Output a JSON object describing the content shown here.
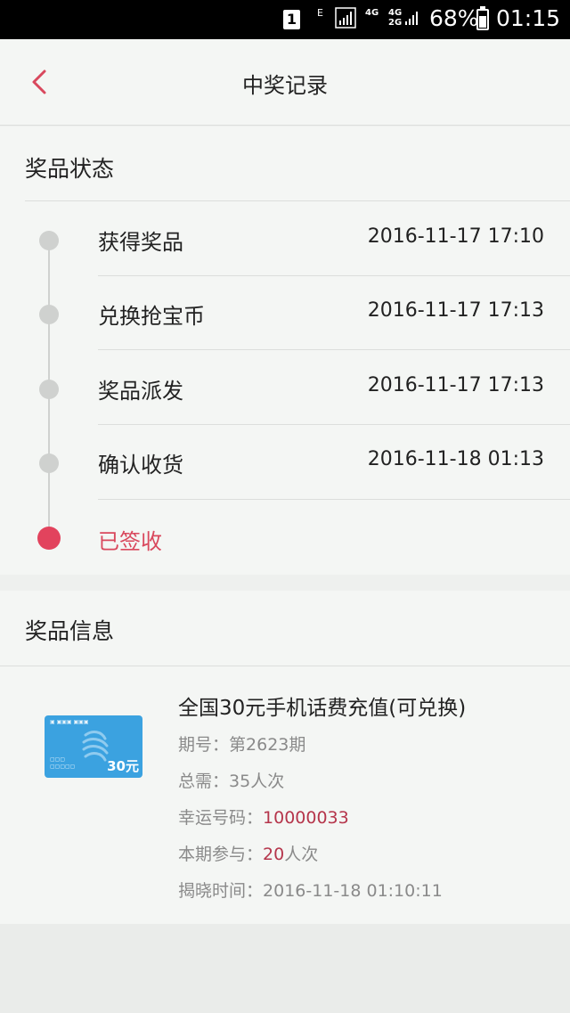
{
  "status_bar": {
    "sim": "1",
    "net1": "E",
    "net2_top": "4G",
    "net2_bottom": "",
    "net3_top": "4G",
    "net3_bottom": "2G",
    "battery": "68%",
    "time": "01:15"
  },
  "header": {
    "title": "中奖记录"
  },
  "status_section": {
    "title": "奖品状态",
    "steps": [
      {
        "label": "获得奖品",
        "time": "2016-11-17 17:10"
      },
      {
        "label": "兑换抢宝币",
        "time": "2016-11-17 17:13"
      },
      {
        "label": "奖品派发",
        "time": "2016-11-17 17:13"
      },
      {
        "label": "确认收货",
        "time": "2016-11-18 01:13"
      },
      {
        "label": "已签收",
        "time": ""
      }
    ]
  },
  "info_section": {
    "title": "奖品信息",
    "card_value": "30元",
    "prize_name": "全国30元手机话费充值(可兑换)",
    "issue_label": "期号：",
    "issue_value": "第2623期",
    "need_label": "总需：",
    "need_value": "35人次",
    "lucky_label": "幸运号码：",
    "lucky_value": "10000033",
    "join_label": "本期参与：",
    "join_count": "20",
    "join_unit": "人次",
    "reveal_label": "揭晓时间：",
    "reveal_value": "2016-11-18 01:10:11"
  },
  "colors": {
    "accent": "#e2435d",
    "highlight": "#b5354b",
    "inactive_dot": "#cfd1cf",
    "card_blue": "#3ba2e0"
  }
}
